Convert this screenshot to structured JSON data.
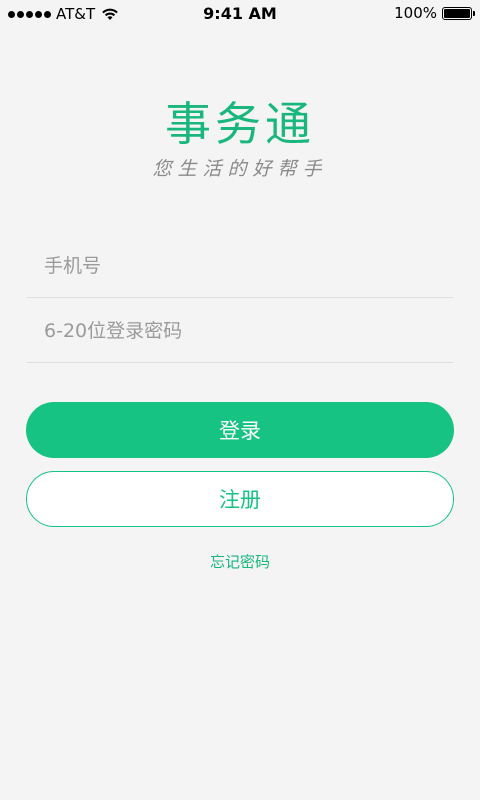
{
  "status_bar": {
    "carrier": "AT&T",
    "time": "9:41 AM",
    "battery": "100%"
  },
  "app": {
    "logo_text": "事务通",
    "slogan": "您生活的好帮手"
  },
  "form": {
    "phone_placeholder": "手机号",
    "password_placeholder": "6-20位登录密码"
  },
  "buttons": {
    "login_label": "登录",
    "register_label": "注册"
  },
  "links": {
    "forgot_password": "忘记密码"
  },
  "colors": {
    "accent": "#16c383",
    "background": "#f4f4f4"
  }
}
